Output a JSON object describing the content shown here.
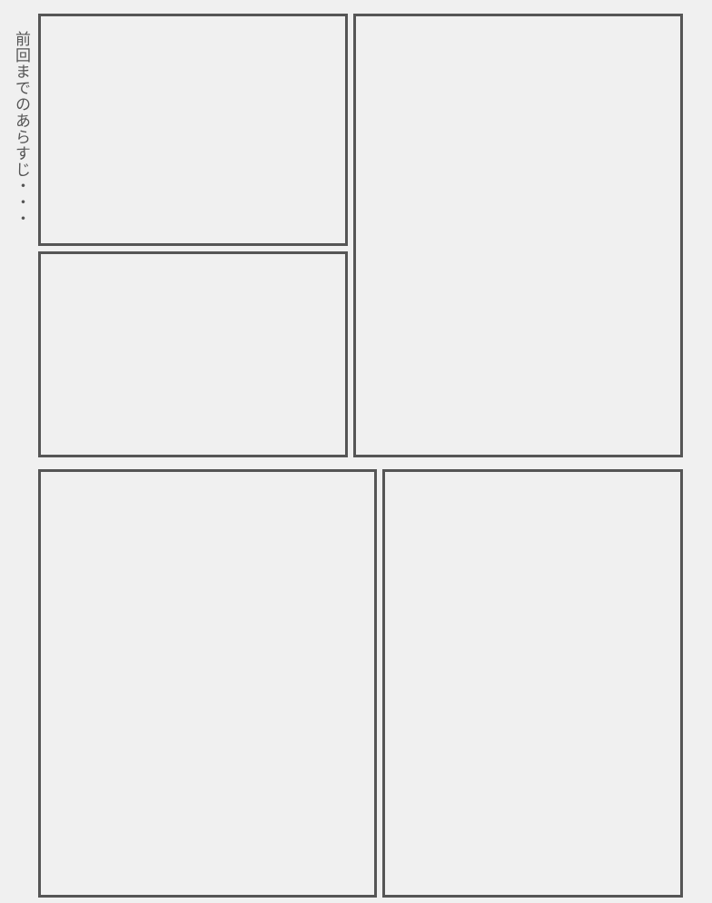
{
  "page": {
    "caption": "前回までのあらすじ・・・"
  },
  "colors": {
    "background": "#f0f0f0",
    "panel_border": "#555555",
    "caption_text": "#555555"
  }
}
